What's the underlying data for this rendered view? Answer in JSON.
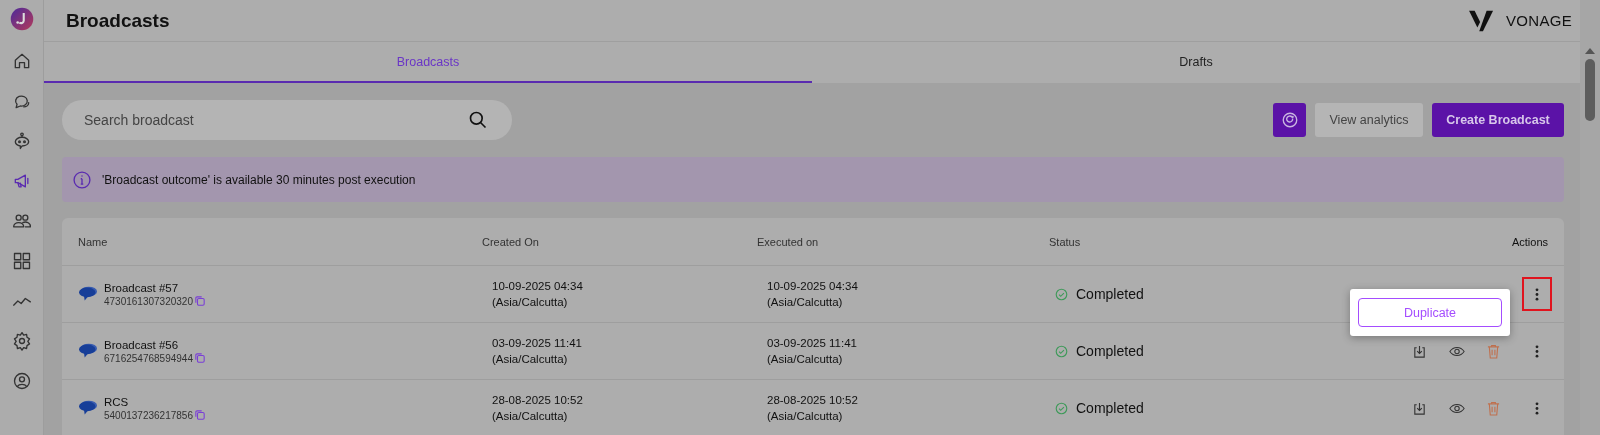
{
  "sidebar": {
    "items": [
      {
        "kind": "home",
        "selected": false
      },
      {
        "kind": "chat",
        "selected": false
      },
      {
        "kind": "bot",
        "selected": false
      },
      {
        "kind": "broadcast",
        "selected": true
      },
      {
        "kind": "contacts",
        "selected": false
      },
      {
        "kind": "apps",
        "selected": false
      },
      {
        "kind": "analytics",
        "selected": false
      },
      {
        "kind": "settings",
        "selected": false
      },
      {
        "kind": "profile",
        "selected": false
      }
    ]
  },
  "header": {
    "title": "Broadcasts",
    "brand": "VONAGE"
  },
  "tabs": [
    {
      "label": "Broadcasts",
      "selected": true
    },
    {
      "label": "Drafts",
      "selected": false
    }
  ],
  "search": {
    "placeholder": "Search broadcast"
  },
  "toolbar": {
    "buttons": [
      {
        "kind": "refresh"
      },
      {
        "kind": "secondary",
        "label": "View analytics"
      },
      {
        "kind": "primary",
        "label": "Create Broadcast"
      }
    ]
  },
  "banner": {
    "text": "'Broadcast outcome' is available 30 minutes post execution"
  },
  "table": {
    "columns": [
      "Name",
      "Created On",
      "Executed on",
      "Status",
      "Actions"
    ],
    "rows": [
      {
        "name": "Broadcast #57",
        "id": "4730161307320320",
        "created": [
          "10-09-2025 04:34",
          "(Asia/Calcutta)"
        ],
        "executed": [
          "10-09-2025 04:34",
          "(Asia/Calcutta)"
        ],
        "status": "Completed",
        "menu_open": true,
        "highlighted": true,
        "menu": [
          "Duplicate"
        ]
      },
      {
        "name": "Broadcast #56",
        "id": "6716254768594944",
        "created": [
          "03-09-2025 11:41",
          "(Asia/Calcutta)"
        ],
        "executed": [
          "03-09-2025 11:41",
          "(Asia/Calcutta)"
        ],
        "status": "Completed",
        "menu_open": false,
        "highlighted": false
      },
      {
        "name": "RCS",
        "id": "5400137236217856",
        "created": [
          "28-08-2025 10:52",
          "(Asia/Calcutta)"
        ],
        "executed": [
          "28-08-2025 10:52",
          "(Asia/Calcutta)"
        ],
        "status": "Completed",
        "menu_open": false,
        "highlighted": false
      }
    ]
  }
}
